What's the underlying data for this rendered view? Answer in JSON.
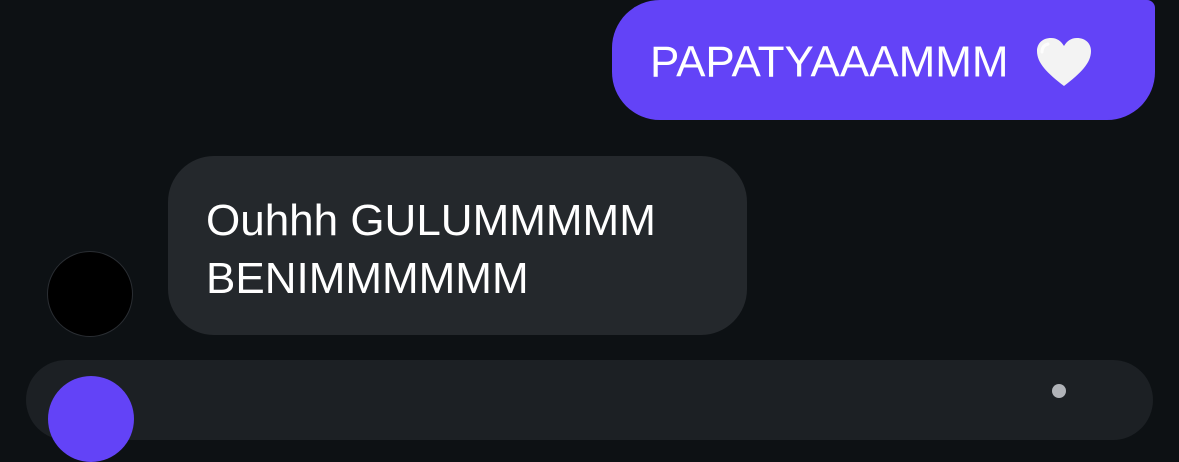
{
  "messages": [
    {
      "direction": "outgoing",
      "text": "PAPATYAAAMMM",
      "emoji": "white-heart",
      "color": "#6343f7"
    },
    {
      "direction": "incoming",
      "lines": [
        "Ouhhh GULUMMMMM",
        "BENIMMMMMM"
      ],
      "color": "#24282c"
    }
  ],
  "composer": {
    "accent": "#6343f7"
  }
}
